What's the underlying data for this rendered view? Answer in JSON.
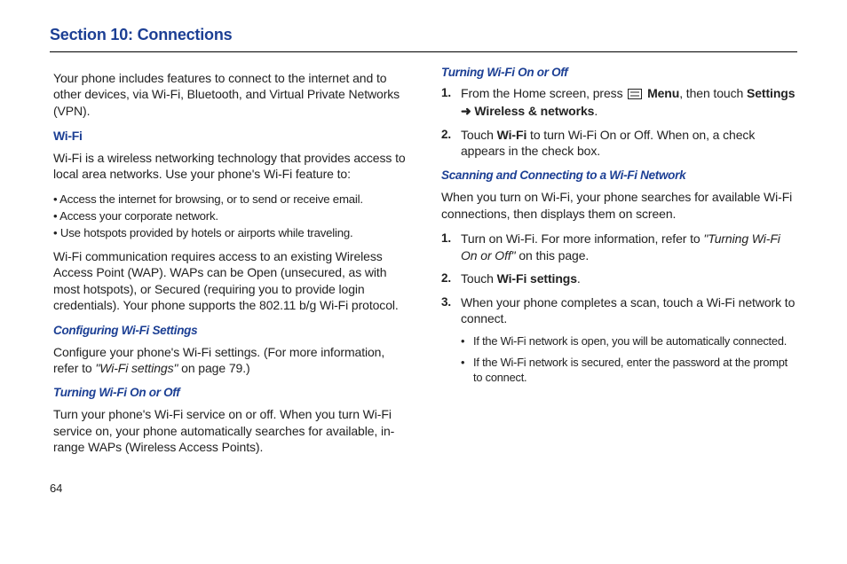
{
  "page": {
    "title": "Section 10: Connections",
    "page_number": "64"
  },
  "left": {
    "intro": "Your phone includes features to connect to the internet and to other devices, via Wi-Fi, Bluetooth, and Virtual Private Networks (VPN).",
    "wifi_heading": "Wi-Fi",
    "wifi_intro": "Wi-Fi is a wireless networking technology that provides access to local area networks. Use your phone's Wi-Fi feature to:",
    "wifi_bullets": [
      "Access the internet for browsing, or to send or receive email.",
      "Access your corporate network.",
      "Use hotspots provided by hotels or airports while traveling."
    ],
    "wifi_para2": "Wi-Fi communication requires access to an existing Wireless Access Point (WAP). WAPs can be Open (unsecured, as with most hotspots), or Secured (requiring you to provide login credentials). Your phone supports the 802.11 b/g Wi-Fi protocol.",
    "config_head": "Configuring Wi-Fi Settings",
    "config_body_pre": "Configure your phone's Wi-Fi settings. (For more information, refer to ",
    "config_ref": "\"Wi-Fi settings\"",
    "config_body_post": " on page 79.)",
    "onoff_head": "Turning Wi-Fi On or Off",
    "onoff_body": "Turn your phone's Wi-Fi service on or off. When you turn Wi-Fi service on, your phone automatically searches for available, in-range WAPs (Wireless Access Points)."
  },
  "right": {
    "onoff_head": "Turning Wi-Fi On or Off",
    "step1_pre": "From the Home screen, press ",
    "step1_menu": "Menu",
    "step1_mid": ", then touch ",
    "step1_settings": "Settings",
    "step1_arrow": " ➜ ",
    "step1_wireless": "Wireless & networks",
    "step1_end": ".",
    "step2_pre": "Touch ",
    "step2_wifi": "Wi-Fi",
    "step2_post": " to turn Wi-Fi On or Off. When on, a check appears in the check box.",
    "scan_head": "Scanning and Connecting to a Wi-Fi Network",
    "scan_intro": "When you turn on Wi-Fi, your phone searches for available Wi-Fi connections, then displays them on screen.",
    "scan_step1_pre": "Turn on Wi-Fi. For more information, refer to ",
    "scan_step1_ref": "\"Turning Wi-Fi On or Off\"",
    "scan_step1_post": " on this page.",
    "scan_step2_pre": "Touch ",
    "scan_step2_ref": "Wi-Fi settings",
    "scan_step2_post": ".",
    "scan_step3": "When your phone completes a scan, touch a Wi-Fi network to connect.",
    "scan_sub1": "If the Wi-Fi network is open, you will be automatically connected.",
    "scan_sub2": "If the Wi-Fi network is secured, enter the password at the prompt to connect."
  }
}
